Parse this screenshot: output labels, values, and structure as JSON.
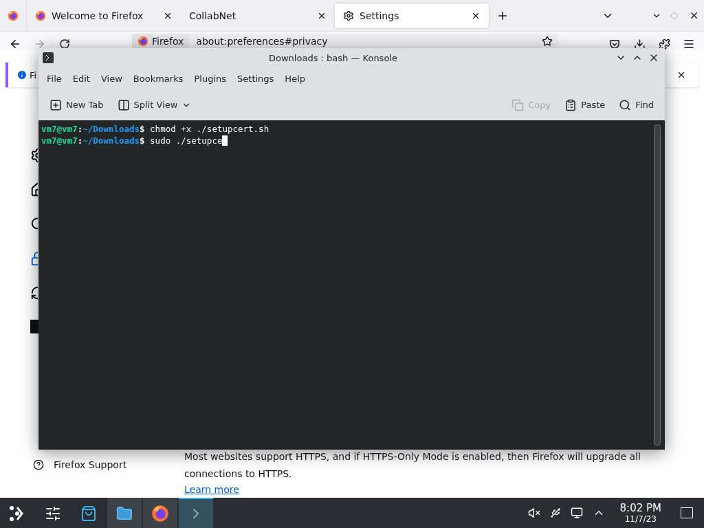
{
  "browser": {
    "tabs": [
      {
        "kind": "firefox",
        "label": "Welcome to Firefox",
        "selected": false
      },
      {
        "kind": "plain",
        "label": "CollabNet",
        "selected": false
      },
      {
        "kind": "settings",
        "label": "Settings",
        "selected": true
      }
    ],
    "url_bar": {
      "identity": "Firefox",
      "url": "about:preferences#privacy"
    },
    "notification": {
      "text": "Fi"
    },
    "sidebar": {
      "support": "Firefox Support"
    },
    "content": {
      "paragraph": "Most websites support HTTPS, and if HTTPS-Only Mode is enabled, then Firefox will upgrade all connections to HTTPS.",
      "link": "Learn more"
    }
  },
  "konsole": {
    "title": "Downloads : bash — Konsole",
    "menu": [
      "File",
      "Edit",
      "View",
      "Bookmarks",
      "Plugins",
      "Settings",
      "Help"
    ],
    "toolbar": [
      {
        "kind": "new-tab",
        "label": "New Tab",
        "disabled": false
      },
      {
        "kind": "split-view",
        "label": "Split View",
        "disabled": false
      },
      {
        "kind": "copy",
        "label": "Copy",
        "disabled": true
      },
      {
        "kind": "paste",
        "label": "Paste",
        "disabled": false
      },
      {
        "kind": "find",
        "label": "Find",
        "disabled": false
      }
    ],
    "lines": [
      {
        "user": "vm7@vm7",
        "sep": ":",
        "path": "~/Downloads",
        "sign": "$",
        "command": "chmod +x ./setupcert.sh",
        "cursor": false
      },
      {
        "user": "vm7@vm7",
        "sep": ":",
        "path": "~/Downloads",
        "sign": "$",
        "command": "sudo ./setupce",
        "cursor": true
      }
    ]
  },
  "taskbar": {
    "apps": [
      {
        "kind": "settings",
        "open": false,
        "active": false
      },
      {
        "kind": "store",
        "open": false,
        "active": false
      },
      {
        "kind": "files",
        "open": true,
        "active": false
      },
      {
        "kind": "firefox",
        "open": true,
        "active": false
      },
      {
        "kind": "terminal",
        "open": true,
        "active": true
      }
    ],
    "clock": {
      "time": "8:02 PM",
      "date": "11/7/23"
    }
  }
}
